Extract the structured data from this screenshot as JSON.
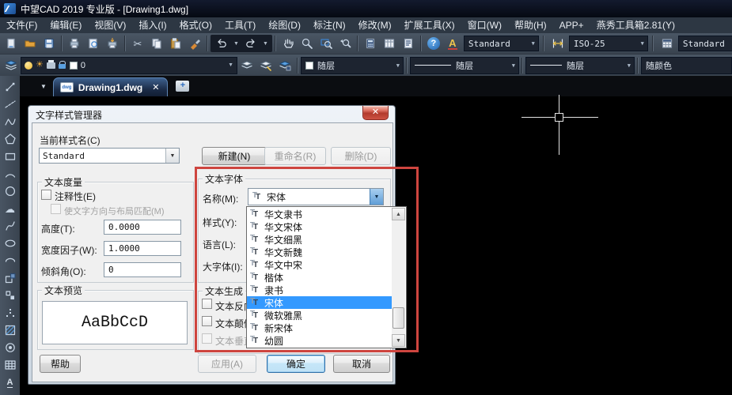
{
  "window": {
    "title": "中望CAD 2019 专业版 - [Drawing1.dwg]"
  },
  "menu": {
    "items": [
      "文件(F)",
      "编辑(E)",
      "视图(V)",
      "插入(I)",
      "格式(O)",
      "工具(T)",
      "绘图(D)",
      "标注(N)",
      "修改(M)",
      "扩展工具(X)",
      "窗口(W)",
      "帮助(H)",
      "APP+",
      "燕秀工具箱2.81(Y)"
    ]
  },
  "toolbar_standard": {
    "text_style": "Standard",
    "dim_style": "ISO-25",
    "table_style": "Standard"
  },
  "toolbar_layers": {
    "layer_name": "0",
    "color": "随层",
    "linetype": "随层",
    "lineweight": "随层",
    "plot_style": "随颜色"
  },
  "tab_bar": {
    "active_tab": "Drawing1.dwg"
  },
  "dialog": {
    "title": "文字样式管理器",
    "current_style_label": "当前样式名(C)",
    "current_style_value": "Standard",
    "new_button": "新建(N)",
    "rename_button": "重命名(R)",
    "delete_button": "删除(D)",
    "metrics": {
      "group_label": "文本度量",
      "annotative_label": "注释性(E)",
      "match_layout_label": "使文字方向与布局匹配(M)",
      "height_label": "高度(T):",
      "height_value": "0.0000",
      "width_factor_label": "宽度因子(W):",
      "width_factor_value": "1.0000",
      "oblique_label": "倾斜角(O):",
      "oblique_value": "0"
    },
    "preview": {
      "group_label": "文本预览",
      "sample_text": "AaBbCcD"
    },
    "font": {
      "group_label": "文本字体",
      "name_label": "名称(M):",
      "name_value": "宋体",
      "style_label": "样式(Y):",
      "language_label": "语言(L):",
      "big_font_label": "大字体(I):"
    },
    "font_dropdown": {
      "items": [
        "华文隶书",
        "华文宋体",
        "华文细黑",
        "华文新魏",
        "华文中宋",
        "楷体",
        "隶书",
        "宋体",
        "微软雅黑",
        "新宋体",
        "幼圆"
      ],
      "selected": "宋体"
    },
    "generation": {
      "group_label": "文本生成",
      "backwards_label": "文本反向",
      "upside_down_label": "文本颠倒",
      "vertical_label": "文本垂直"
    },
    "footer": {
      "help": "帮助",
      "apply": "应用(A)",
      "ok": "确定",
      "cancel": "取消"
    }
  },
  "icons": {
    "dropdown-arrow": "▼",
    "up-arrow": "▲",
    "close-x": "✕",
    "scissors": "✂",
    "cloud": "☁",
    "sun": "☀",
    "help": "?",
    "new-tab-plus": "+",
    "text-a": "A",
    "dwg-badge": "dwg",
    "truetype": "TT"
  },
  "colors": {
    "annotation_red": "#ce453f",
    "selection_blue": "#3399ff",
    "titlebar_bg": "#070c18",
    "toolbar_bg": "#3e4a58",
    "tab_blue": "#2c4b73"
  }
}
